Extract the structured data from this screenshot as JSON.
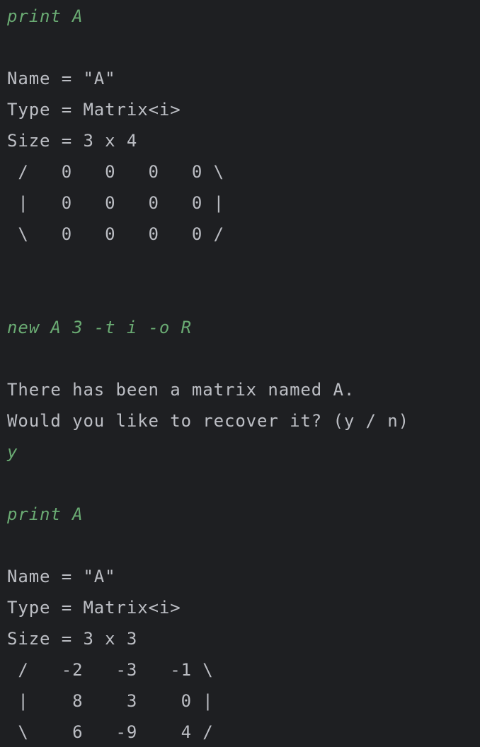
{
  "console": {
    "lines": [
      {
        "kind": "input",
        "text": "print A"
      },
      {
        "kind": "blank",
        "text": ""
      },
      {
        "kind": "output",
        "text": "Name = \"A\""
      },
      {
        "kind": "output",
        "text": "Type = Matrix<i>"
      },
      {
        "kind": "output",
        "text": "Size = 3 x 4"
      },
      {
        "kind": "output",
        "text": " /   0   0   0   0 \\"
      },
      {
        "kind": "output",
        "text": " |   0   0   0   0 |"
      },
      {
        "kind": "output",
        "text": " \\   0   0   0   0 /"
      },
      {
        "kind": "blank",
        "text": ""
      },
      {
        "kind": "blank",
        "text": ""
      },
      {
        "kind": "input",
        "text": "new A 3 -t i -o R"
      },
      {
        "kind": "blank",
        "text": ""
      },
      {
        "kind": "output",
        "text": "There has been a matrix named A."
      },
      {
        "kind": "output",
        "text": "Would you like to recover it? (y / n)"
      },
      {
        "kind": "input",
        "text": "y"
      },
      {
        "kind": "blank",
        "text": ""
      },
      {
        "kind": "input",
        "text": "print A"
      },
      {
        "kind": "blank",
        "text": ""
      },
      {
        "kind": "output",
        "text": "Name = \"A\""
      },
      {
        "kind": "output",
        "text": "Type = Matrix<i>"
      },
      {
        "kind": "output",
        "text": "Size = 3 x 3"
      },
      {
        "kind": "output",
        "text": " /   -2   -3   -1 \\"
      },
      {
        "kind": "output",
        "text": " |    8    3    0 |"
      },
      {
        "kind": "output",
        "text": " \\    6   -9    4 /"
      }
    ]
  },
  "colors": {
    "background": "#1e1f22",
    "output_text": "#bcbec4",
    "input_text": "#6aab73"
  }
}
